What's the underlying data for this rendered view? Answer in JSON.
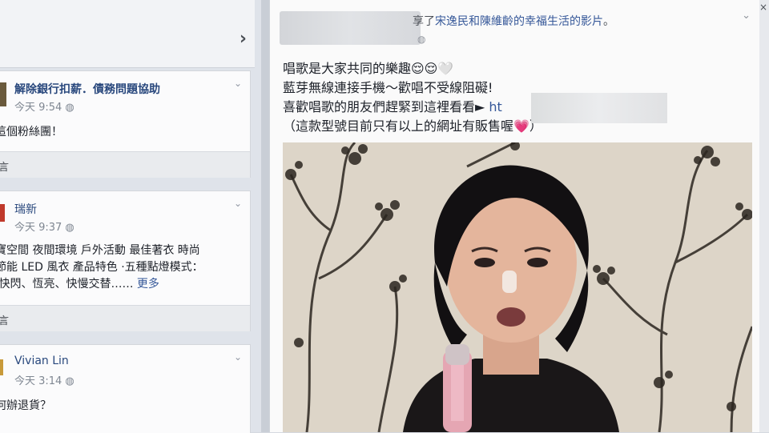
{
  "left_panel": {
    "cards": [
      {
        "name": "解除銀行扣薪．債務問題協助",
        "time": "今天 9:54",
        "body_lines": [
          "這個粉絲團！"
        ],
        "footer": "言",
        "avatar_color": "#6a5a3c"
      },
      {
        "name": "瑞新",
        "time": "今天 9:37",
        "body_lines": [
          "寶空間 夜間環境 戶外活動 最佳著衣 時尚",
          "節能 LED 風衣 產品特色 ·五種點燈模式：",
          "·快閃、恆亮、快慢交替……"
        ],
        "more": "更多",
        "footer": "言",
        "avatar_color": "#c0392b"
      },
      {
        "name": "Vivian Lin",
        "time": "今天 3:14",
        "body_lines": [
          "何辦退貨？"
        ],
        "avatar_color": "#c89a3a"
      }
    ]
  },
  "post": {
    "headline_prefix": "享了",
    "headline_link": "宋逸民和陳維齡的幸福生活的影片",
    "headline_suffix": "。",
    "text_lines": [
      "唱歌是大家共同的樂趣😌😌🤍",
      "藍芽無線連接手機～歡唱不受線阻礙!",
      "喜歡唱歌的朋友們趕緊到這裡看看► ",
      "（這款型號目前只有以上的網址有販售喔💗）"
    ],
    "link_text": "ht",
    "icons": {
      "privacy": "globe-icon",
      "menu": "chevron-down-icon"
    }
  },
  "colors": {
    "link": "#365899",
    "name": "#29487d"
  }
}
